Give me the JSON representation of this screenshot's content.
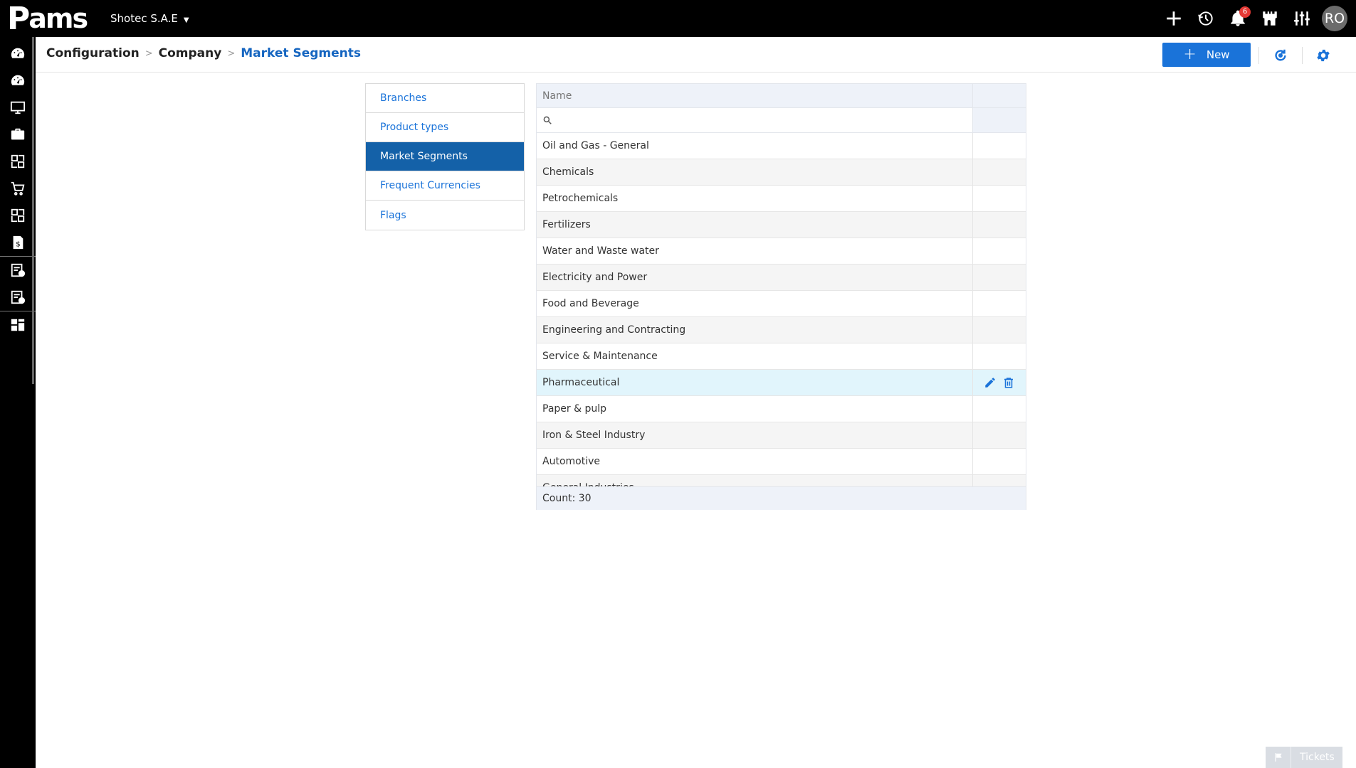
{
  "app": {
    "logo_text": "ams",
    "logo_mark": "P"
  },
  "company": {
    "name": "Shotec S.A.E"
  },
  "topbar": {
    "icons": [
      "plus-icon",
      "history-icon",
      "bell-icon",
      "castle-icon",
      "sliders-icon"
    ],
    "notification_count": "6",
    "avatar_initials": "RO"
  },
  "sidebar": {
    "items": [
      "dashboard-icon",
      "dashboard-alt-icon",
      "monitor-icon",
      "briefcase-icon",
      "modules-icon",
      "cart-icon",
      "modules-alt-icon",
      "invoice-icon",
      "checklist-icon",
      "report-icon",
      "layout-icon"
    ]
  },
  "breadcrumb": {
    "items": [
      "Configuration",
      "Company"
    ],
    "current": "Market Segments"
  },
  "header": {
    "new_label": "New"
  },
  "tabs": [
    {
      "label": "Branches",
      "active": false
    },
    {
      "label": "Product types",
      "active": false
    },
    {
      "label": "Market Segments",
      "active": true
    },
    {
      "label": "Frequent Currencies",
      "active": false
    },
    {
      "label": "Flags",
      "active": false
    }
  ],
  "grid": {
    "column_name": "Name",
    "filter_placeholder": "",
    "rows": [
      "Oil and Gas - General",
      "Chemicals",
      "Petrochemicals",
      "Fertilizers",
      "Water and Waste water",
      "Electricity and Power",
      "Food and Beverage",
      "Engineering and Contracting",
      "Service & Maintenance",
      "Pharmaceutical",
      "Paper & pulp",
      "Iron & Steel Industry",
      "Automotive",
      "General Industries"
    ],
    "hovered_row": 9,
    "count_text": "Count: 30"
  },
  "tickets": {
    "label": "Tickets"
  },
  "colors": {
    "accent": "#1a73d9",
    "active_tab": "#1461a8",
    "topbar": "#000000",
    "hover_row": "#e1f5fc"
  }
}
